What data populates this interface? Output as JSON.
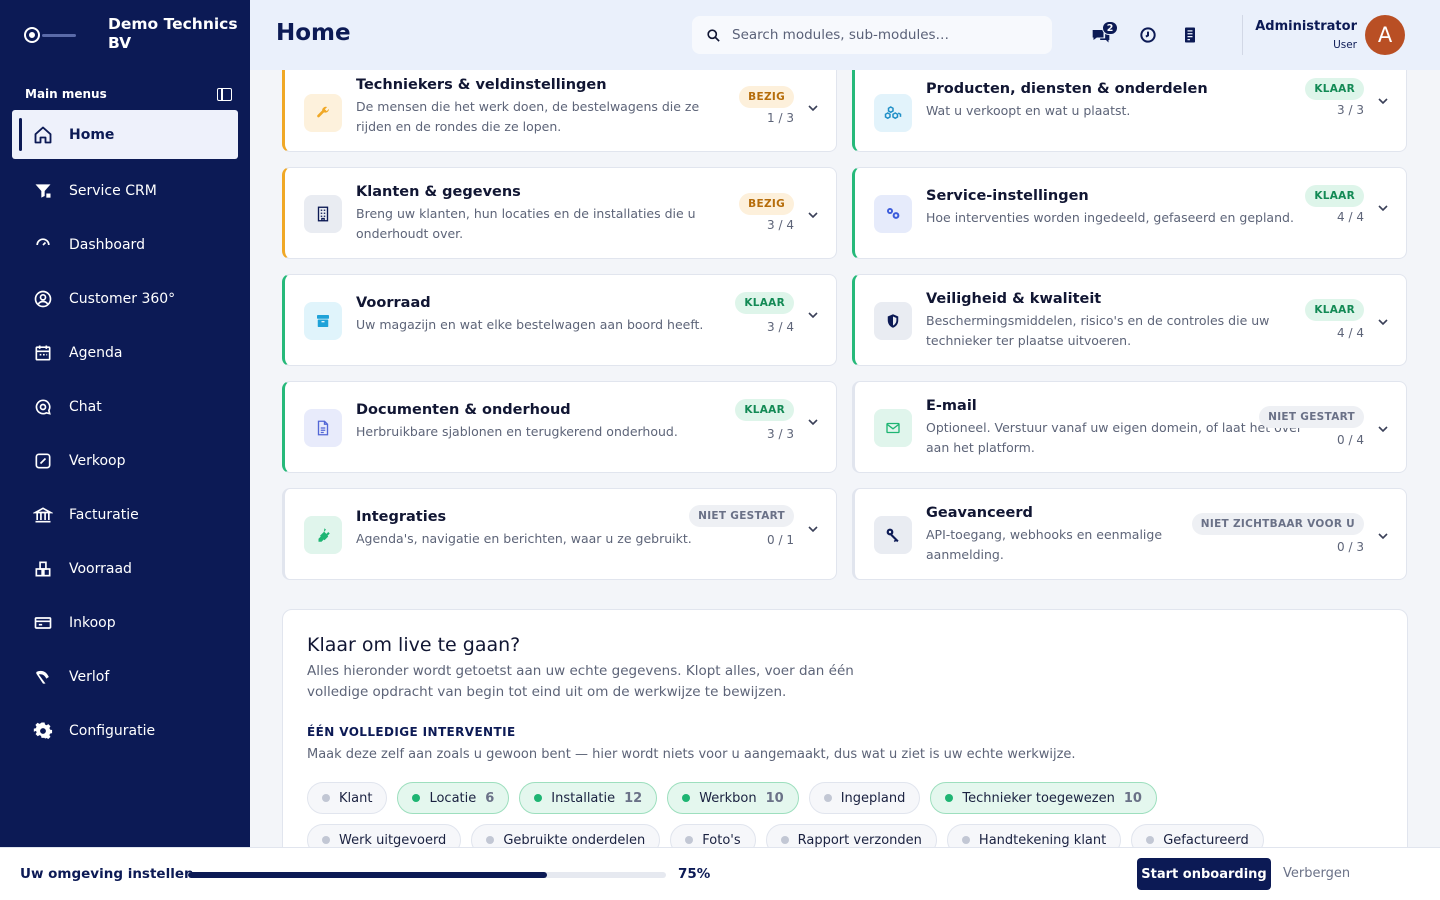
{
  "brand": {
    "name": "Demo Technics BV"
  },
  "sidebar": {
    "section_label": "Main menus",
    "items": [
      {
        "label": "Home",
        "icon": "home-icon"
      },
      {
        "label": "Service CRM",
        "icon": "filter-icon"
      },
      {
        "label": "Dashboard",
        "icon": "gauge-icon"
      },
      {
        "label": "Customer 360°",
        "icon": "user-circle-icon"
      },
      {
        "label": "Agenda",
        "icon": "calendar-icon"
      },
      {
        "label": "Chat",
        "icon": "chat-icon"
      },
      {
        "label": "Verkoop",
        "icon": "sales-icon"
      },
      {
        "label": "Facturatie",
        "icon": "bank-icon"
      },
      {
        "label": "Voorraad",
        "icon": "inventory-icon"
      },
      {
        "label": "Inkoop",
        "icon": "card-icon"
      },
      {
        "label": "Verlof",
        "icon": "leave-icon"
      },
      {
        "label": "Configuratie",
        "icon": "gear-icon"
      }
    ]
  },
  "header": {
    "title": "Home",
    "search_placeholder": "Search modules, sub-modules…",
    "chat_badge": "2",
    "user_name": "Administrator",
    "user_role": "User",
    "avatar_letter": "A"
  },
  "cards": [
    {
      "title": "Techniekers & veldinstellingen",
      "desc": "De mensen die het werk doen, de bestelwagens die ze rijden en de rondes die ze lopen.",
      "status": "BEZIG",
      "count": "1 / 3"
    },
    {
      "title": "Producten, diensten & onderdelen",
      "desc": "Wat u verkoopt en wat u plaatst.",
      "status": "KLAAR",
      "count": "3 / 3"
    },
    {
      "title": "Klanten & gegevens",
      "desc": "Breng uw klanten, hun locaties en de installaties die u onderhoudt over.",
      "status": "BEZIG",
      "count": "3 / 4"
    },
    {
      "title": "Service-instellingen",
      "desc": "Hoe interventies worden ingedeeld, gefaseerd en gepland.",
      "status": "KLAAR",
      "count": "4 / 4"
    },
    {
      "title": "Voorraad",
      "desc": "Uw magazijn en wat elke bestelwagen aan boord heeft.",
      "status": "KLAAR",
      "count": "3 / 4"
    },
    {
      "title": "Veiligheid & kwaliteit",
      "desc": "Beschermingsmiddelen, risico's en de controles die uw technieker ter plaatse uitvoeren.",
      "status": "KLAAR",
      "count": "4 / 4"
    },
    {
      "title": "Documenten & onderhoud",
      "desc": "Herbruikbare sjablonen en terugkerend onderhoud.",
      "status": "KLAAR",
      "count": "3 / 3"
    },
    {
      "title": "E-mail",
      "desc": "Optioneel. Verstuur vanaf uw eigen domein, of laat het over aan het platform.",
      "status": "NIET GESTART",
      "count": "0 / 4"
    },
    {
      "title": "Integraties",
      "desc": "Agenda's, navigatie en berichten, waar u ze gebruikt.",
      "status": "NIET GESTART",
      "count": "0 / 1"
    },
    {
      "title": "Geavanceerd",
      "desc": "API-toegang, webhooks en eenmalige aanmelding.",
      "status": "NIET ZICHTBAAR VOOR U",
      "count": "0 / 3"
    }
  ],
  "live": {
    "title": "Klaar om live te gaan?",
    "desc": "Alles hieronder wordt getoetst aan uw echte gegevens. Klopt alles, voer dan één volledige opdracht van begin tot eind uit om de werkwijze te bewijzen.",
    "sub_title": "ÉÉN VOLLEDIGE INTERVENTIE",
    "sub_desc": "Maak deze zelf aan zoals u gewoon bent — hier wordt niets voor u aangemaakt, dus wat u ziet is uw echte werkwijze.",
    "chips": [
      {
        "label": "Klant",
        "num": "",
        "done": false
      },
      {
        "label": "Locatie",
        "num": "6",
        "done": true
      },
      {
        "label": "Installatie",
        "num": "12",
        "done": true
      },
      {
        "label": "Werkbon",
        "num": "10",
        "done": true
      },
      {
        "label": "Ingepland",
        "num": "",
        "done": false
      },
      {
        "label": "Technieker toegewezen",
        "num": "10",
        "done": true
      },
      {
        "label": "Werk uitgevoerd",
        "num": "",
        "done": false
      },
      {
        "label": "Gebruikte onderdelen",
        "num": "",
        "done": false
      },
      {
        "label": "Foto's",
        "num": "",
        "done": false
      },
      {
        "label": "Rapport verzonden",
        "num": "",
        "done": false
      },
      {
        "label": "Handtekening klant",
        "num": "",
        "done": false
      },
      {
        "label": "Gefactureerd",
        "num": "",
        "done": false
      }
    ]
  },
  "bottombar": {
    "title": "Uw omgeving instellen",
    "progress": 75,
    "pct_label": "75%",
    "start_label": "Start onboarding",
    "hide_label": "Verbergen"
  },
  "colors": {
    "sidebar": "#0c1a55",
    "accent_green": "#26b97a",
    "accent_yellow": "#f0a826"
  }
}
